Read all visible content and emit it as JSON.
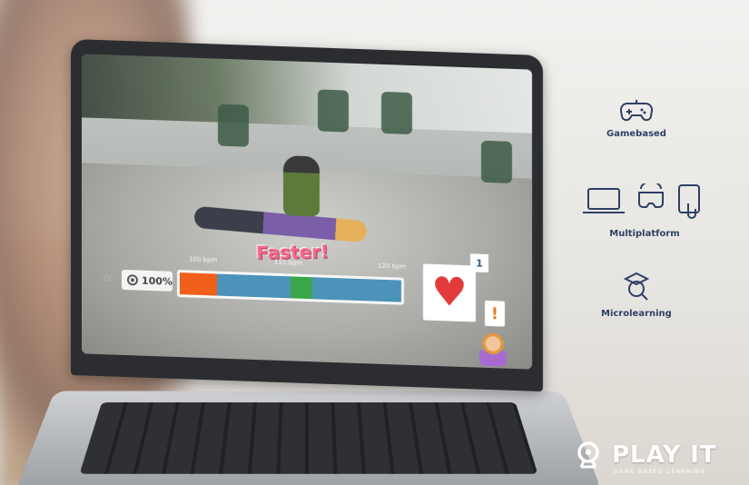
{
  "game": {
    "feedback_text": "Faster!",
    "score_percent": "100%",
    "bpm_low": "100 bpm",
    "bpm_mid": "110 bpm",
    "bpm_high": "120 bpm",
    "heart_count": "1",
    "alert_symbol": "!",
    "bar": {
      "red_fraction": 0.17,
      "green_start_fraction": 0.5,
      "green_width_fraction": 0.1
    },
    "colors": {
      "bar_bg": "#4b93b8",
      "bar_red": "#f0601a",
      "bar_green": "#3aa64a",
      "heart": "#e23b3b",
      "alert": "#f07b1c"
    },
    "icons": [
      "star-icon",
      "target-icon",
      "heart-icon",
      "alert-icon",
      "nurse-avatar"
    ]
  },
  "features": [
    {
      "label": "Gamebased",
      "icon": "gamepad-icon"
    },
    {
      "label": "Multiplatform",
      "icon": "devices-icon"
    },
    {
      "label": "Microlearning",
      "icon": "graduation-search-icon"
    }
  ],
  "brand": {
    "name": "PLAY IT",
    "tagline": "GAME BASED LEARNING",
    "icon": "magnifier-logo-icon"
  }
}
